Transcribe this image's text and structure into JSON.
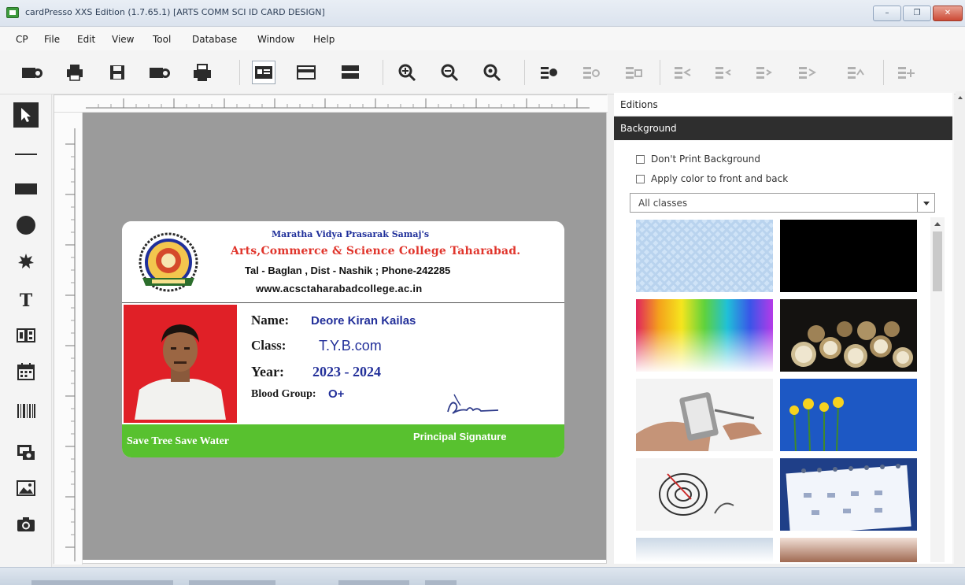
{
  "window": {
    "title": "cardPresso XXS Edition (1.7.65.1) [ARTS COMM SCI ID CARD DESIGN]",
    "controls": {
      "minimize": "–",
      "maximize": "❐",
      "close": "✕"
    }
  },
  "menu": [
    "CP",
    "File",
    "Edit",
    "View",
    "Tool",
    "Database",
    "Window",
    "Help"
  ],
  "toolbar": {
    "icons": [
      "new-card-icon",
      "print-icon",
      "save-icon",
      "open-card-icon",
      "printer-settings-icon",
      "card-front-icon",
      "card-back-icon",
      "both-sides-icon",
      "zoom-in-icon",
      "zoom-out-icon",
      "zoom-fit-icon",
      "align-icon",
      "align-icon",
      "align-icon",
      "align-icon",
      "align-icon",
      "align-icon",
      "align-icon",
      "align-icon",
      "align-icon"
    ]
  },
  "palette": {
    "tools": [
      "pointer-icon",
      "line-icon",
      "rectangle-icon",
      "ellipse-icon",
      "star-icon",
      "text-icon",
      "qr-icon",
      "calendar-icon",
      "barcode-icon",
      "photo-capture-icon",
      "image-icon",
      "camera-icon"
    ],
    "text_tool_glyph": "T"
  },
  "card": {
    "society": "Maratha Vidya Prasarak Samaj's",
    "college": "Arts,Commerce & Science College Taharabad.",
    "address": "Tal - Baglan , Dist - Nashik ; Phone-242285",
    "website": "www.acsctaharabadcollege.ac.in",
    "name_label": "Name:",
    "name_value": "Deore Kiran Kailas",
    "class_label": "Class:",
    "class_value": "T.Y.B.com",
    "year_label": "Year:",
    "year_value": "2023 - 2024",
    "blood_label": "Blood Group:",
    "blood_value": "O+",
    "slogan": "Save Tree Save Water",
    "signature_caption": "Principal Signature",
    "colors": {
      "header_text": "#1f2f9a",
      "college_text": "#e0352c",
      "value_text": "#23309a",
      "footer": "#58c12f",
      "photo_border": "#e02027"
    }
  },
  "panel": {
    "tab_editions": "Editions",
    "tab_background": "Background",
    "checkbox_no_print": "Don't Print Background",
    "checkbox_apply_color": "Apply color to front and back",
    "class_filter": "All classes",
    "thumbnails": [
      "transparent-pattern",
      "black",
      "color-spectrum",
      "alarm-clocks",
      "hand-with-phone",
      "yellow-flowers",
      "love-target",
      "calendar-spiral",
      "sky",
      "ring-binder"
    ]
  }
}
